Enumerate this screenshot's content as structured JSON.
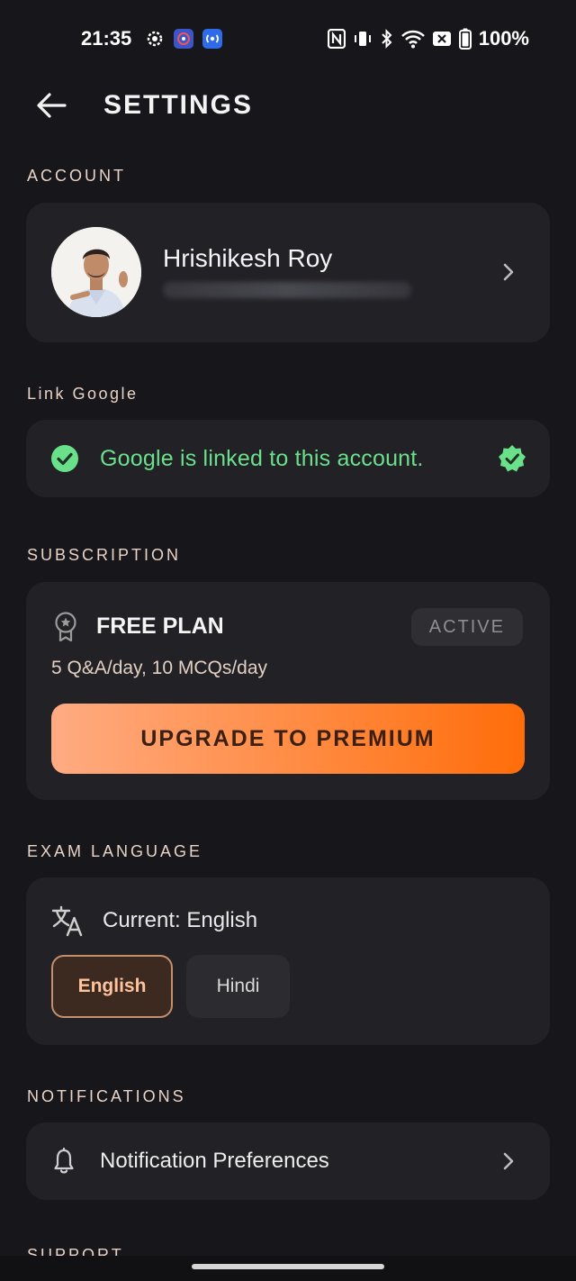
{
  "status_bar": {
    "time": "21:35",
    "battery": "100%",
    "left_icons": [
      "settings-gear-icon",
      "app-notification-icon",
      "broadcast-app-icon"
    ],
    "right_icons": [
      "nfc-icon",
      "vibrate-icon",
      "bluetooth-icon",
      "wifi-icon",
      "no-sim-icon",
      "battery-icon"
    ]
  },
  "header": {
    "title": "SETTINGS",
    "back_icon": "arrow-left-icon"
  },
  "account": {
    "section_label": "ACCOUNT",
    "name": "Hrishikesh Roy",
    "email_blurred": true
  },
  "link_google": {
    "section_label": "Link Google",
    "status_text": "Google is linked to this account.",
    "accent": "#6be08b"
  },
  "subscription": {
    "section_label": "SUBSCRIPTION",
    "plan_name": "FREE PLAN",
    "badge": "ACTIVE",
    "description": "5 Q&A/day, 10 MCQs/day",
    "upgrade_label": "UPGRADE TO PREMIUM",
    "upgrade_colors": [
      "#ffab82",
      "#ff6d0a"
    ]
  },
  "exam_language": {
    "section_label": "EXAM LANGUAGE",
    "current_text": "Current: English",
    "options": [
      {
        "label": "English",
        "selected": true
      },
      {
        "label": "Hindi",
        "selected": false
      }
    ]
  },
  "notifications": {
    "section_label": "NOTIFICATIONS",
    "preferences_label": "Notification Preferences"
  },
  "support": {
    "section_label": "SUPPORT"
  },
  "colors": {
    "background": "#17171b",
    "card": "#212126",
    "section_label": "#e9d3c6"
  }
}
